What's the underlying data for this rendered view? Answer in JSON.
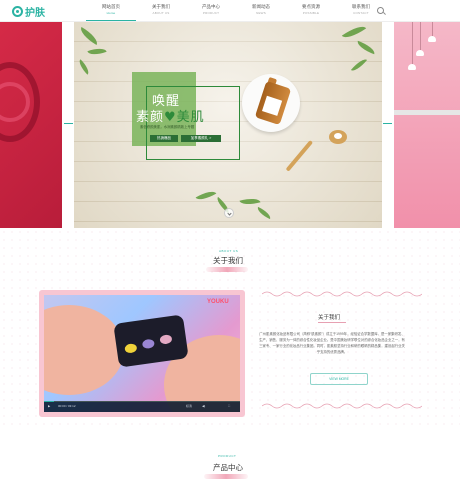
{
  "header": {
    "logo": "护肤",
    "nav": [
      {
        "zh": "网站首页",
        "en": "Home",
        "active": true
      },
      {
        "zh": "关于我们",
        "en": "ABOUT US",
        "active": false
      },
      {
        "zh": "产品中心",
        "en": "PRODUCT",
        "active": false
      },
      {
        "zh": "新闻动态",
        "en": "NEWS",
        "active": false
      },
      {
        "zh": "要点资源",
        "en": "POSSIBLE",
        "active": false
      },
      {
        "zh": "联系我们",
        "en": "CONTACT",
        "active": false
      }
    ]
  },
  "banner": {
    "headline1": "唤醒",
    "headline2_left": "素颜",
    "headline2_heart": "♥",
    "headline2_right": "美肌",
    "subline": "素色修颜美肌，水润素颜精致上专题",
    "btn_hot": "热销爆品",
    "btn_join": "加享素颜礼 >"
  },
  "about": {
    "section_en": "ABOUT US",
    "section_title": "关于我们",
    "title": "关于我们",
    "body": "广州肌素颜化妆品有限公司（简称“肌素颜”）成立于1999年，经验证合学数据库，是一家集研发、生产、销售、服务为一体的综合性化妆品企业。是中国美妆研学联位对的综合化妆品企业之一，有三家专、一家行业的化妆品行业集团。同时，肌素颜坚持行业和研的眼睛的精品集，建设起行业关乎支持的优秀品牌。",
    "view_more": "VIEW MORE"
  },
  "video": {
    "brand": "YOUKU",
    "time": "00:00 / 03:12",
    "quality": "标清",
    "progress": 0.05
  },
  "products": {
    "section_en": "PRODUCT",
    "section_title": "产品中心"
  }
}
